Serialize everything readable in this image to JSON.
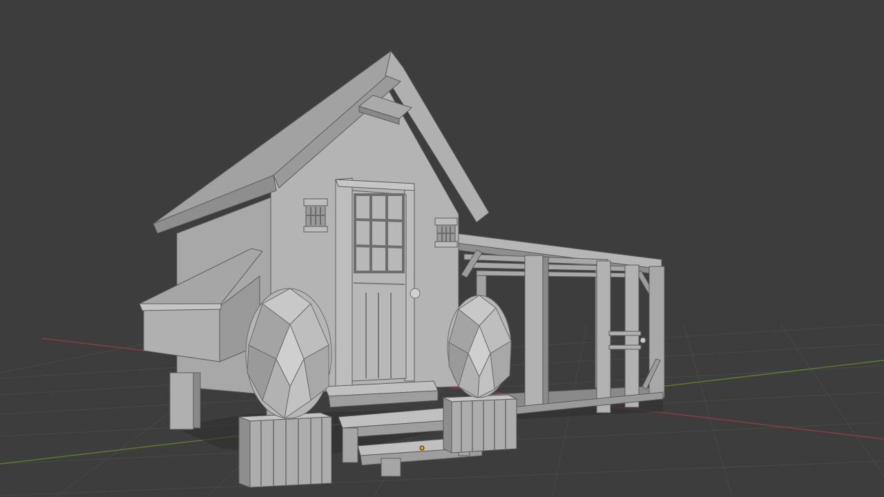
{
  "app": {
    "name": "3D viewport",
    "view": "solid-shading",
    "grid": true,
    "axes": [
      "x-axis-line",
      "y-axis-line"
    ]
  },
  "scene": {
    "model": "chicken-coop",
    "parts": [
      "gable-roof",
      "roof-vent",
      "coop-body",
      "nesting-box",
      "nesting-box-lid",
      "front-door",
      "door-window",
      "door-knob",
      "wall-lantern-left",
      "wall-lantern-right",
      "stilt-legs",
      "front-steps",
      "egg-sculpture-left",
      "egg-sculpture-right",
      "crate-left",
      "crate-right",
      "pergola-run",
      "run-gate",
      "origin-point"
    ]
  },
  "colors": {
    "background": "#3d3d3d",
    "grid_line": "#4a4a4a",
    "x_axis": "#8c3a44",
    "y_axis": "#5e7a2a",
    "mesh_light": "#b4b4b4",
    "mesh_mid": "#9c9c9c",
    "mesh_dark": "#7a7a7a",
    "edge": "#5a5a5a",
    "origin": "#e8a020"
  }
}
